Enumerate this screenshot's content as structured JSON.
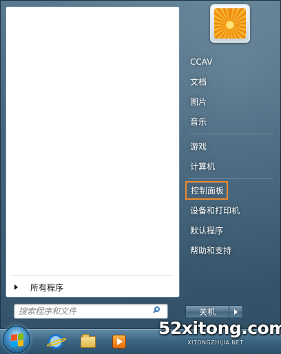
{
  "start_menu": {
    "all_programs_label": "所有程序",
    "search": {
      "placeholder": "搜索程序和文件"
    },
    "right_menu": {
      "user_name": "CCAV",
      "items": [
        "文档",
        "图片",
        "音乐",
        "游戏",
        "计算机",
        "控制面板",
        "设备和打印机",
        "默认程序",
        "帮助和支持"
      ],
      "highlighted_item": "控制面板",
      "highlight_color": "#f08a2a"
    },
    "shutdown_label": "关机"
  },
  "taskbar": {
    "pinned_icons": [
      "internet-explorer-icon",
      "windows-explorer-icon",
      "media-player-icon"
    ]
  },
  "watermark": {
    "main_text": "52xitong.com",
    "sub_text": "XITONGZHIJIA.NET"
  }
}
